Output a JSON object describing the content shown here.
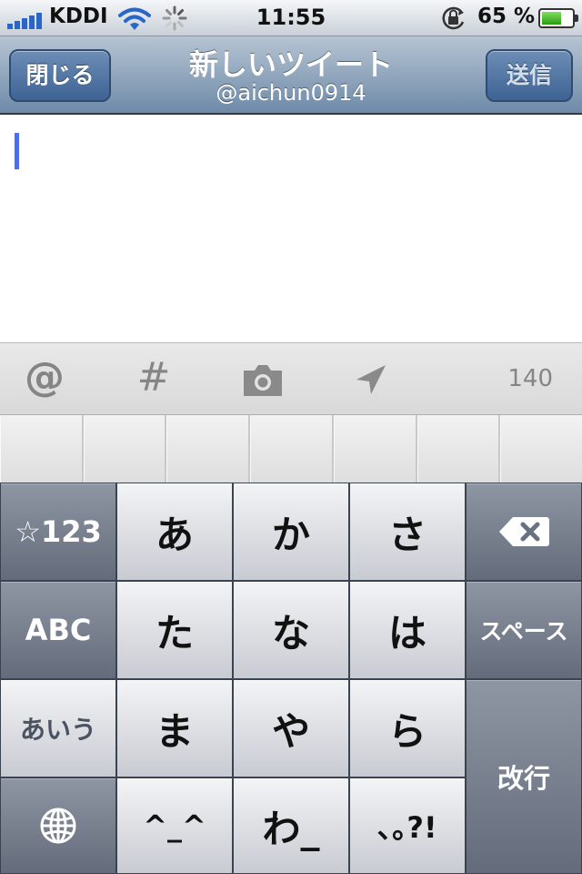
{
  "status_bar": {
    "carrier": "KDDI",
    "time": "11:55",
    "battery_percent": "65 %",
    "battery_level": 0.65,
    "icons": [
      "signal-bars-icon",
      "wifi-icon",
      "activity-spinner-icon",
      "rotation-lock-icon",
      "battery-icon"
    ]
  },
  "nav": {
    "close_label": "閉じる",
    "title": "新しいツイート",
    "subtitle": "@aichun0914",
    "send_label": "送信"
  },
  "toolbar": {
    "mention_symbol": "@",
    "hashtag_symbol": "#",
    "icons": [
      "camera-icon",
      "location-arrow-icon"
    ],
    "char_count": "140"
  },
  "keyboard": {
    "rows": [
      {
        "left": "☆123",
        "keys": [
          "あ",
          "か",
          "さ"
        ],
        "right_icon": "delete-icon"
      },
      {
        "left": "ABC",
        "keys": [
          "た",
          "な",
          "は"
        ],
        "right": "スペース"
      },
      {
        "left": "あいう",
        "keys": [
          "ま",
          "や",
          "ら"
        ],
        "right": "改行"
      },
      {
        "left_icon": "globe-icon",
        "keys": [
          "^_^",
          "わ_",
          "､｡?!"
        ]
      }
    ]
  },
  "colors": {
    "nav_blue": "#6e8aa8",
    "button_blue": "#3e6394",
    "cursor": "#4f6ee6",
    "battery_green": "#2c9b10",
    "key_dark": "#646c7b"
  }
}
